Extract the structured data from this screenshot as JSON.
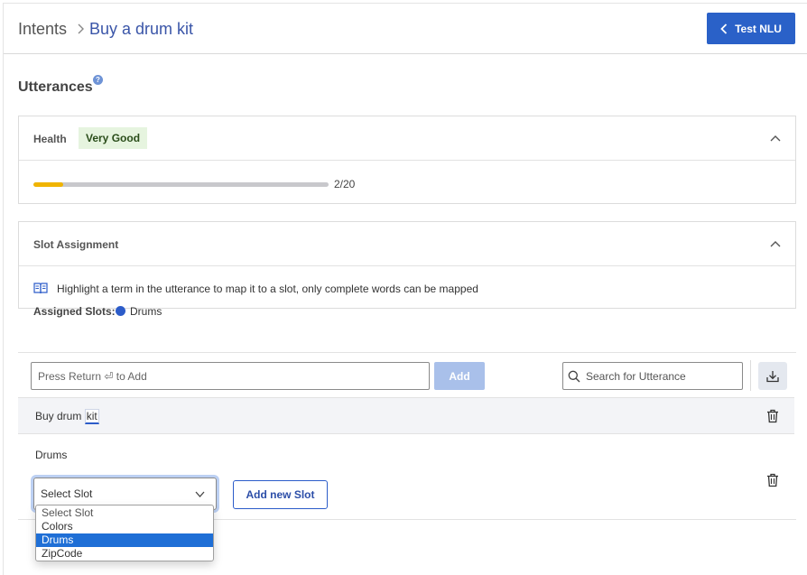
{
  "breadcrumb": {
    "root": "Intents",
    "current": "Buy a drum kit"
  },
  "header": {
    "test_button": "Test NLU"
  },
  "utterances": {
    "title": "Utterances",
    "help_icon": "question-circle-icon"
  },
  "health": {
    "label": "Health",
    "badge": "Very Good",
    "progress_text": "2/20",
    "progress_value": 2,
    "progress_max": 20,
    "fill_color": "#f0b400"
  },
  "slot_assignment": {
    "label": "Slot Assignment",
    "hint": "Highlight a term in the utterance to map it to a slot, only complete words can be mapped",
    "assigned_label": "Assigned Slots:",
    "assigned_slots": [
      {
        "name": "Drums",
        "color": "#2c5cc9"
      }
    ]
  },
  "utterance_input": {
    "placeholder": "Press Return ⏎ to Add",
    "add_button": "Add"
  },
  "search": {
    "placeholder": "Search for Utterance"
  },
  "rows": [
    {
      "text_before": "Buy drum ",
      "highlight": "kit"
    }
  ],
  "slot_editor": {
    "slot_label": "Drums",
    "select_value": "Select Slot",
    "add_new_slot": "Add new Slot",
    "options": [
      "Select Slot",
      "Colors",
      "Drums",
      "ZipCode"
    ],
    "selected_option": "Drums"
  },
  "colors": {
    "accent": "#2a61c8",
    "badge_bg": "#e6f4df",
    "selected_bg": "#1f6fd6"
  }
}
